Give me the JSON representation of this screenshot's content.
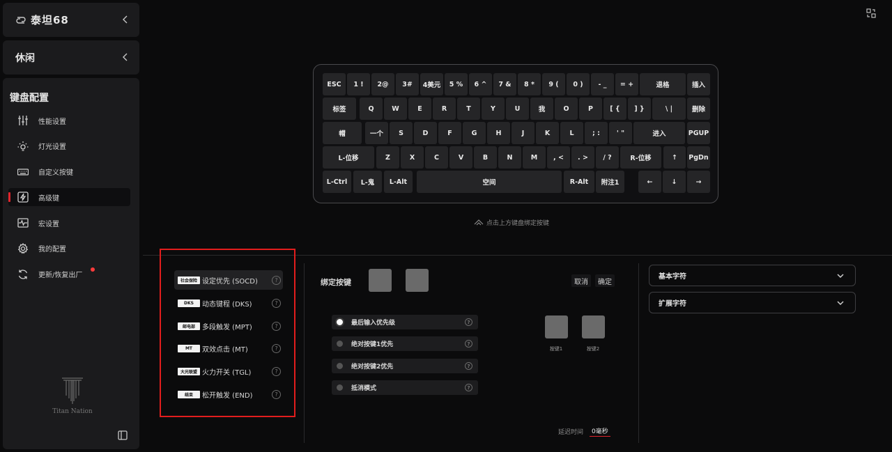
{
  "app": {
    "device_name": "泰坦68",
    "mode": "休闲"
  },
  "sidebar": {
    "section_title": "键盘配置",
    "items": [
      {
        "label": "性能设置",
        "icon": "sliders-icon"
      },
      {
        "label": "灯光设置",
        "icon": "bulb-icon"
      },
      {
        "label": "自定义按键",
        "icon": "keyboard-icon"
      },
      {
        "label": "高级键",
        "icon": "lightning-icon",
        "active": true
      },
      {
        "label": "宏设置",
        "icon": "waveform-icon"
      },
      {
        "label": "我的配置",
        "icon": "gear-icon"
      },
      {
        "label": "更新/恢复出厂",
        "icon": "refresh-icon",
        "badge": "red-dot"
      }
    ],
    "footer_logo": "Titan Nation"
  },
  "keyboard": {
    "rows": [
      [
        "ESC",
        "1 !",
        "2@",
        "3#",
        "4美元",
        "5 %",
        "6 ^",
        "7 &",
        "8 *",
        "9 (",
        "0 )",
        "- _",
        "= +",
        "退格",
        "插入"
      ],
      [
        "标签",
        "Q",
        "W",
        "E",
        "R",
        "T",
        "Y",
        "U",
        "我",
        "O",
        "P",
        "[ {",
        "] }",
        "\\ |",
        "删除"
      ],
      [
        "帽",
        "一个",
        "S",
        "D",
        "F",
        "G",
        "H",
        "J",
        "K",
        "L",
        "; :",
        "' \"",
        "进入",
        "PGUP"
      ],
      [
        "L-位移",
        "Z",
        "X",
        "C",
        "V",
        "B",
        "N",
        "M",
        ", <",
        ". >",
        "/ ?",
        "R-位移",
        "↑",
        "PgDn"
      ],
      [
        "L-Ctrl",
        "L-鬼",
        "L-Alt",
        "空间",
        "R-Alt",
        "附注1",
        "←",
        "↓",
        "→"
      ]
    ],
    "hint": "点击上方键盘绑定按键"
  },
  "advanced_keys": [
    {
      "tag": "社会保险",
      "label": "设定优先 (SOCD)",
      "active": true
    },
    {
      "tag": "DKS",
      "label": "动态键程 (DKS)"
    },
    {
      "tag": "邮电部",
      "label": "多段触发 (MPT)"
    },
    {
      "tag": "MT",
      "label": "双效点击 (MT)"
    },
    {
      "tag": "大光联盟",
      "label": "火力开关 (TGL)"
    },
    {
      "tag": "结束",
      "label": "松开触发 (END)"
    }
  ],
  "bind": {
    "title": "绑定按键",
    "cancel": "取消",
    "confirm": "确定",
    "options": [
      {
        "label": "最后输入优先级",
        "selected": true
      },
      {
        "label": "绝对按键1优先",
        "selected": false
      },
      {
        "label": "绝对按键2优先",
        "selected": false
      },
      {
        "label": "抵消模式",
        "selected": false
      }
    ],
    "key1_label": "按键1",
    "key2_label": "按键2",
    "delay_label": "延迟时间",
    "delay_value": "0毫秒"
  },
  "dropdowns": [
    {
      "label": "基本字符"
    },
    {
      "label": "扩展字符"
    }
  ],
  "help_glyph": "?",
  "colors": {
    "accent": "#e0242c",
    "highlight_border": "#e21d1d",
    "background": "#0b0b0c",
    "panel": "#1b1b1d",
    "key": "#252527"
  }
}
